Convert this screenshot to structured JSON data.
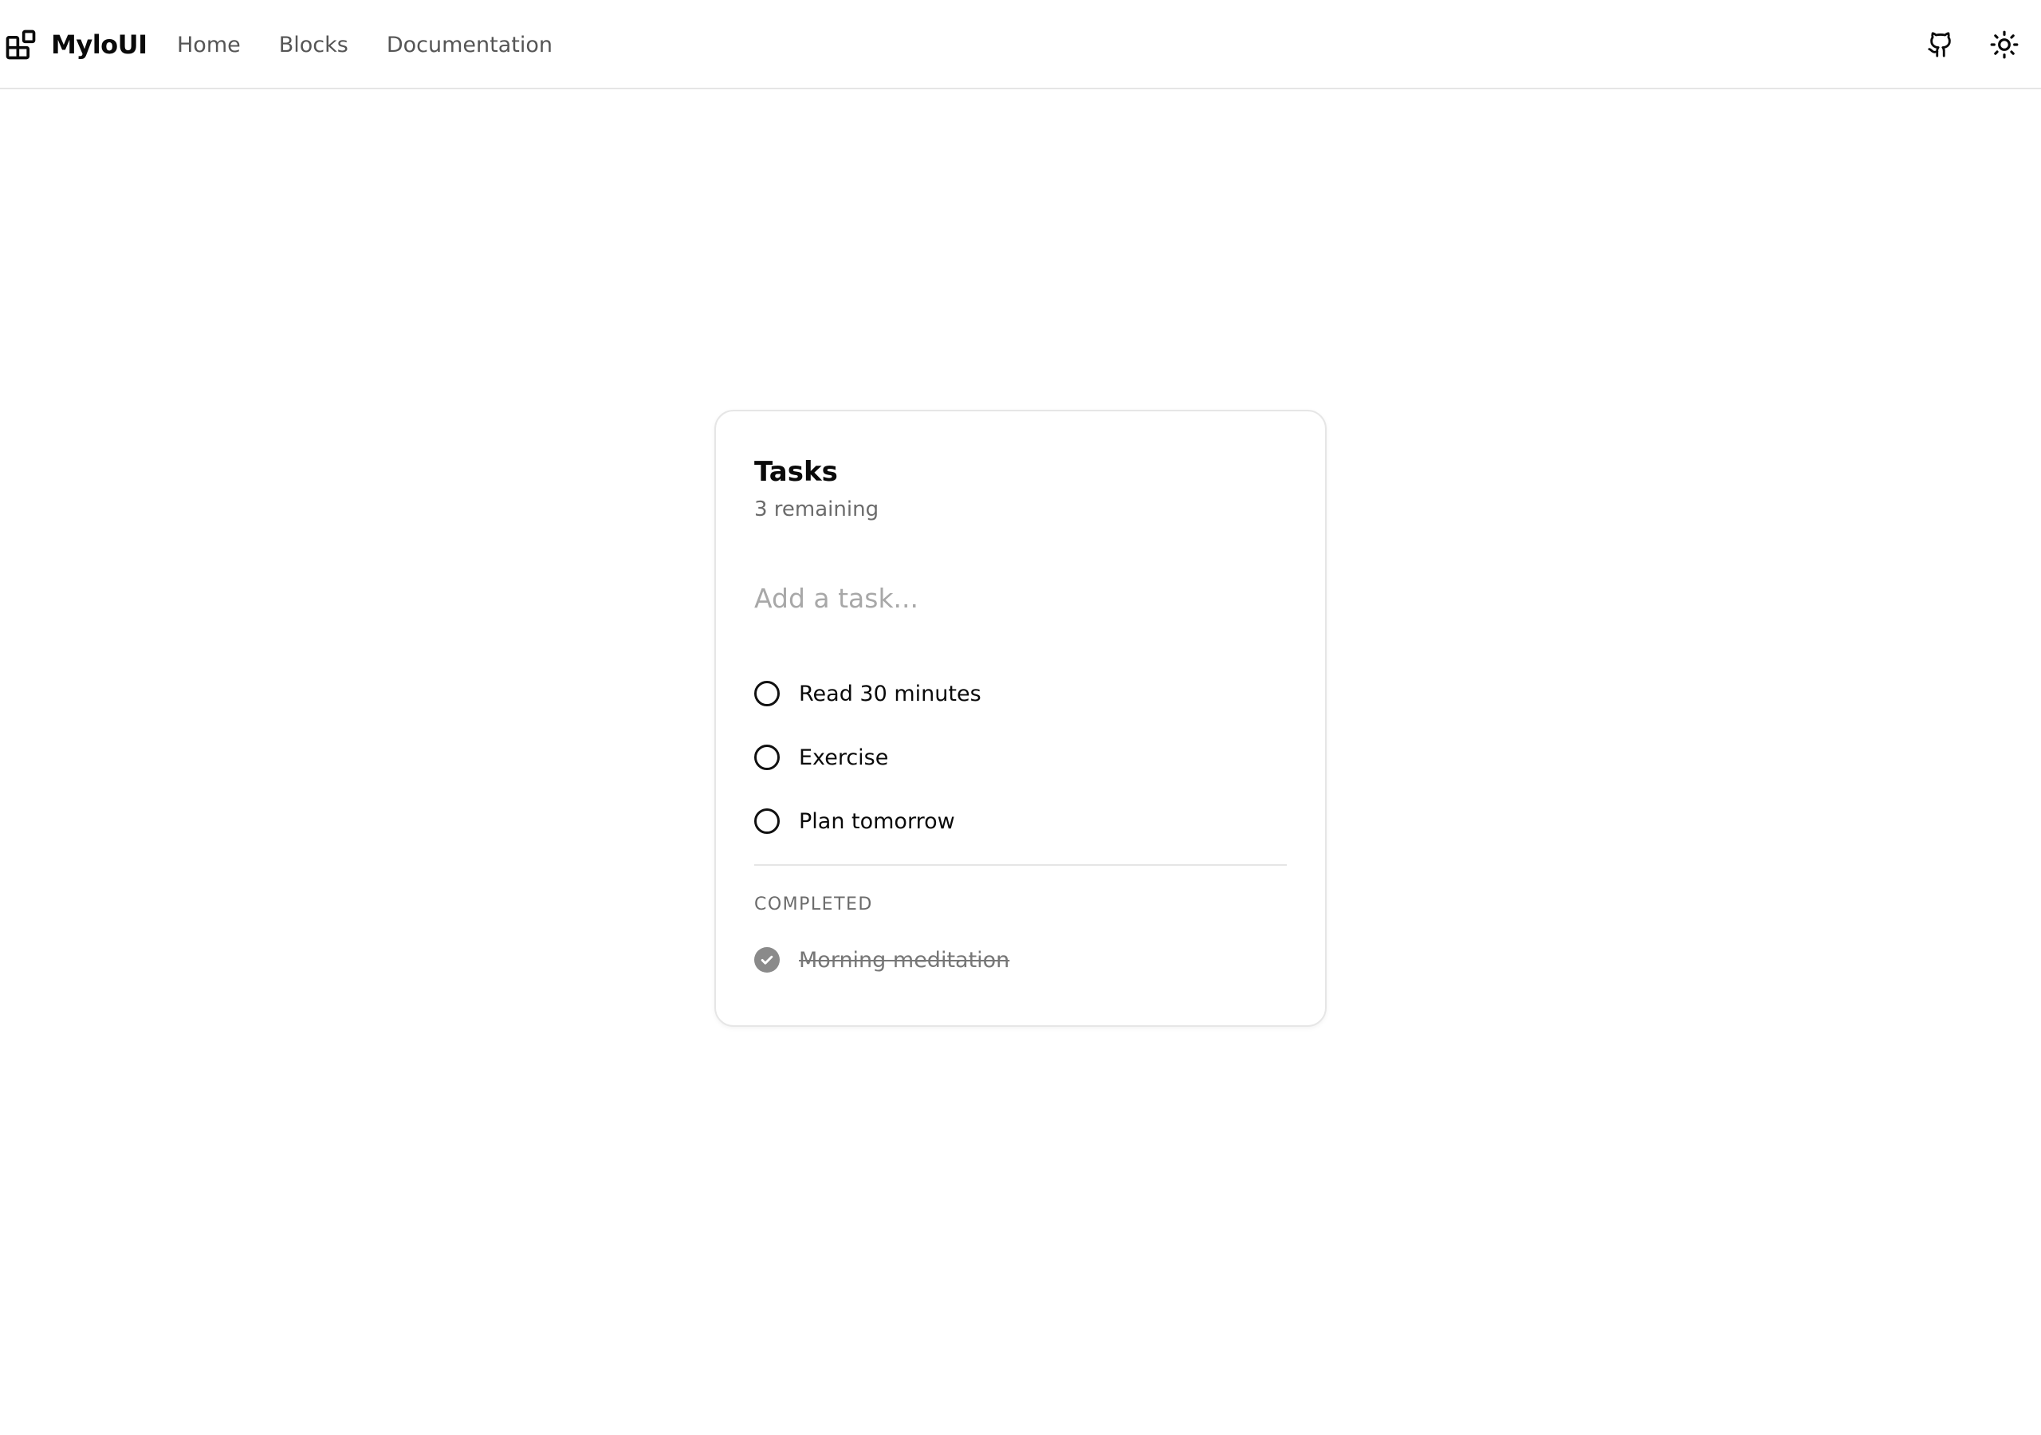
{
  "header": {
    "brand": {
      "name": "MyloUI",
      "icon": "blocks-logo-icon"
    },
    "nav": [
      {
        "label": "Home"
      },
      {
        "label": "Blocks"
      },
      {
        "label": "Documentation"
      }
    ],
    "actions": {
      "github_icon": "github-icon",
      "theme_icon": "sun-icon"
    }
  },
  "tasks_card": {
    "title": "Tasks",
    "remaining_text": "3 remaining",
    "input": {
      "value": "",
      "placeholder": "Add a task..."
    },
    "open_tasks": [
      {
        "label": "Read 30 minutes",
        "done": false
      },
      {
        "label": "Exercise",
        "done": false
      },
      {
        "label": "Plan tomorrow",
        "done": false
      }
    ],
    "completed_section_label": "COMPLETED",
    "completed_tasks": [
      {
        "label": "Morning meditation",
        "done": true
      }
    ]
  },
  "colors": {
    "text_primary": "#0a0a0a",
    "text_muted": "#6b6b6b",
    "placeholder": "#a8a8a8",
    "border": "#e5e5e5",
    "completed_check": "#8a8a8a"
  }
}
